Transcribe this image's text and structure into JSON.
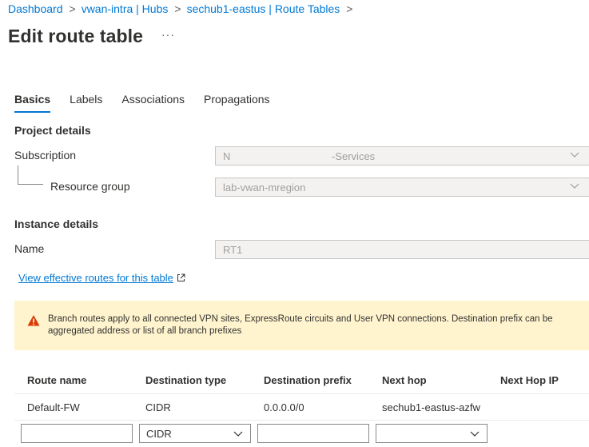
{
  "breadcrumb": {
    "items": [
      "Dashboard",
      "vwan-intra | Hubs",
      "sechub1-eastus | Route Tables"
    ],
    "separator": ">"
  },
  "page": {
    "title": "Edit route table",
    "more_label": "···"
  },
  "tabs": [
    {
      "label": "Basics",
      "active": true
    },
    {
      "label": "Labels",
      "active": false
    },
    {
      "label": "Associations",
      "active": false
    },
    {
      "label": "Propagations",
      "active": false
    }
  ],
  "project_details": {
    "heading": "Project details",
    "subscription": {
      "label": "Subscription",
      "value_left": "N",
      "value_right": "-Services"
    },
    "resource_group": {
      "label": "Resource group",
      "value": "lab-vwan-mregion"
    }
  },
  "instance_details": {
    "heading": "Instance details",
    "name": {
      "label": "Name",
      "value": "RT1"
    }
  },
  "effective_routes_link": "View effective routes for this table",
  "warning": {
    "text": "Branch routes apply to all connected VPN sites, ExpressRoute circuits and User VPN connections. Destination prefix can be aggregated address or list of all branch prefixes",
    "icon": "warning-icon",
    "color": "#fff4ce"
  },
  "routes_table": {
    "columns": [
      "Route name",
      "Destination type",
      "Destination prefix",
      "Next hop",
      "Next Hop IP"
    ],
    "rows": [
      {
        "route_name": "Default-FW",
        "destination_type": "CIDR",
        "destination_prefix": "0.0.0.0/0",
        "next_hop": "sechub1-eastus-azfw",
        "next_hop_ip": ""
      }
    ],
    "new_row": {
      "route_name": "",
      "destination_type": "CIDR",
      "destination_prefix": "",
      "next_hop": ""
    }
  },
  "colors": {
    "accent": "#0078d4",
    "text": "#323130",
    "disabled_bg": "#f3f2f1"
  }
}
